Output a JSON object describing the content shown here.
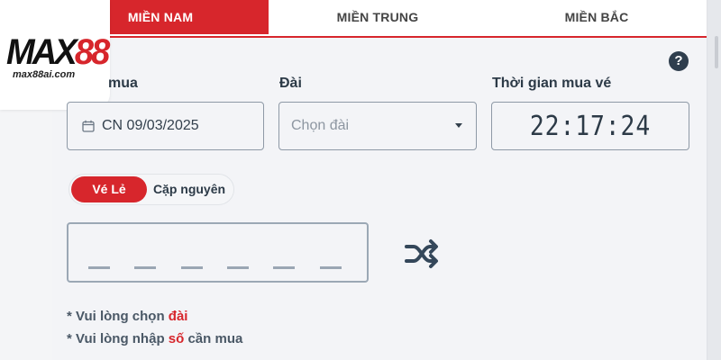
{
  "logo": {
    "text_main": "MAX",
    "text_accent": "88",
    "text_sub": "max88ai.com"
  },
  "tabs": [
    {
      "label": "MIỀN NAM",
      "active": true
    },
    {
      "label": "MIỀN TRUNG",
      "active": false
    },
    {
      "label": "MIỀN BẮC",
      "active": false
    }
  ],
  "help": {
    "label": "?",
    "icon": "question-circle-icon"
  },
  "form": {
    "date_label": "mua",
    "date_value": "CN 09/03/2025",
    "dai_label": "Đài",
    "dai_placeholder": "Chọn đài",
    "time_label": "Thời gian mua vé",
    "time_value": "22:17:24"
  },
  "ticket_type": {
    "options": [
      "Vé Lẻ",
      "Cặp nguyên"
    ],
    "selected": "Vé Lẻ"
  },
  "number_input": {
    "slot_count": 6,
    "shuffle_icon": "shuffle-icon"
  },
  "notes": [
    {
      "prefix": "* Vui lòng chọn ",
      "highlight": "đài",
      "suffix": ""
    },
    {
      "prefix": "* Vui lòng nhập ",
      "highlight": "số",
      "suffix": " cần mua"
    }
  ],
  "colors": {
    "accent": "#d7262c",
    "text": "#2c3a47",
    "border": "#8e99a6"
  }
}
